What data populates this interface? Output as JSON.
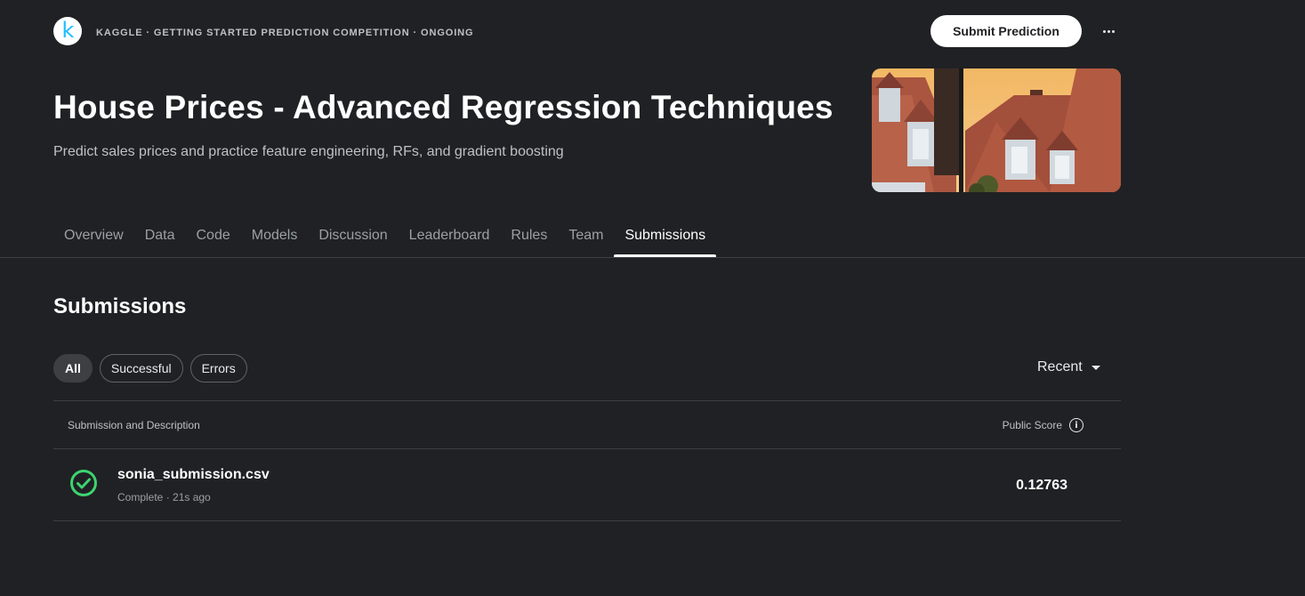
{
  "header": {
    "logo_letter": "k",
    "breadcrumb": "KAGGLE · GETTING STARTED PREDICTION COMPETITION · ONGOING",
    "submit_label": "Submit Prediction"
  },
  "competition": {
    "title": "House Prices - Advanced Regression Techniques",
    "subtitle": "Predict sales prices and practice feature engineering, RFs, and gradient boosting"
  },
  "tabs": [
    {
      "label": "Overview"
    },
    {
      "label": "Data"
    },
    {
      "label": "Code"
    },
    {
      "label": "Models"
    },
    {
      "label": "Discussion"
    },
    {
      "label": "Leaderboard"
    },
    {
      "label": "Rules"
    },
    {
      "label": "Team"
    },
    {
      "label": "Submissions",
      "active": true
    }
  ],
  "submissions": {
    "heading": "Submissions",
    "filters": [
      {
        "label": "All",
        "active": true
      },
      {
        "label": "Successful"
      },
      {
        "label": "Errors"
      }
    ],
    "sort_label": "Recent",
    "columns": {
      "left": "Submission and Description",
      "right": "Public Score"
    },
    "rows": [
      {
        "file": "sonia_submission.csv",
        "meta": "Complete · 21s ago",
        "score": "0.12763",
        "status": "complete"
      }
    ]
  },
  "colors": {
    "background": "#202124",
    "success": "#3dd470",
    "logo_accent": "#20beff"
  },
  "icons": [
    "kaggle-logo",
    "more-horiz-icon",
    "caret-down-icon",
    "info-icon",
    "check-circle-icon"
  ]
}
